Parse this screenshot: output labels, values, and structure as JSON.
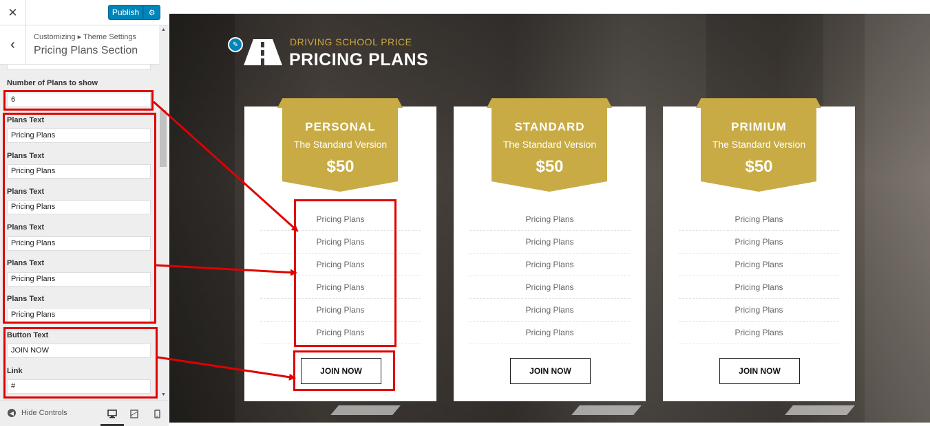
{
  "topbar": {
    "close_icon": "close-icon",
    "publish_label": "Publish",
    "settings_icon": "gear-icon"
  },
  "panel": {
    "breadcrumb": "Customizing ▸ Theme Settings",
    "title": "Pricing Plans Section",
    "back_icon": "chevron-left-icon"
  },
  "controls": {
    "plans_count_label": "Number of Plans to show",
    "plans_count_value": "6",
    "plan_texts": [
      {
        "label": "Plans Text",
        "value": "Pricing Plans"
      },
      {
        "label": "Plans Text",
        "value": "Pricing Plans"
      },
      {
        "label": "Plans Text",
        "value": "Pricing Plans"
      },
      {
        "label": "Plans Text",
        "value": "Pricing Plans"
      },
      {
        "label": "Plans Text",
        "value": "Pricing Plans"
      },
      {
        "label": "Plans Text",
        "value": "Pricing Plans"
      }
    ],
    "button_text_label": "Button Text",
    "button_text_value": "JOIN NOW",
    "link_label": "Link",
    "link_value": "#"
  },
  "footer": {
    "hide_controls": "Hide Controls"
  },
  "preview": {
    "section_subtitle": "DRIVING SCHOOL PRICE",
    "section_title": "PRICING PLANS",
    "plans": [
      {
        "name": "PERSONAL",
        "version": "The Standard Version",
        "price": "$50",
        "features": [
          "Pricing Plans",
          "Pricing Plans",
          "Pricing Plans",
          "Pricing Plans",
          "Pricing Plans",
          "Pricing Plans"
        ],
        "button": "JOIN NOW"
      },
      {
        "name": "STANDARD",
        "version": "The Standard Version",
        "price": "$50",
        "features": [
          "Pricing Plans",
          "Pricing Plans",
          "Pricing Plans",
          "Pricing Plans",
          "Pricing Plans",
          "Pricing Plans"
        ],
        "button": "JOIN NOW"
      },
      {
        "name": "PRIMIUM",
        "version": "The Standard Version",
        "price": "$50",
        "features": [
          "Pricing Plans",
          "Pricing Plans",
          "Pricing Plans",
          "Pricing Plans",
          "Pricing Plans",
          "Pricing Plans"
        ],
        "button": "JOIN NOW"
      }
    ]
  },
  "colors": {
    "accent": "#c8ab45",
    "publish": "#0085ba",
    "annotation": "#e00000"
  }
}
